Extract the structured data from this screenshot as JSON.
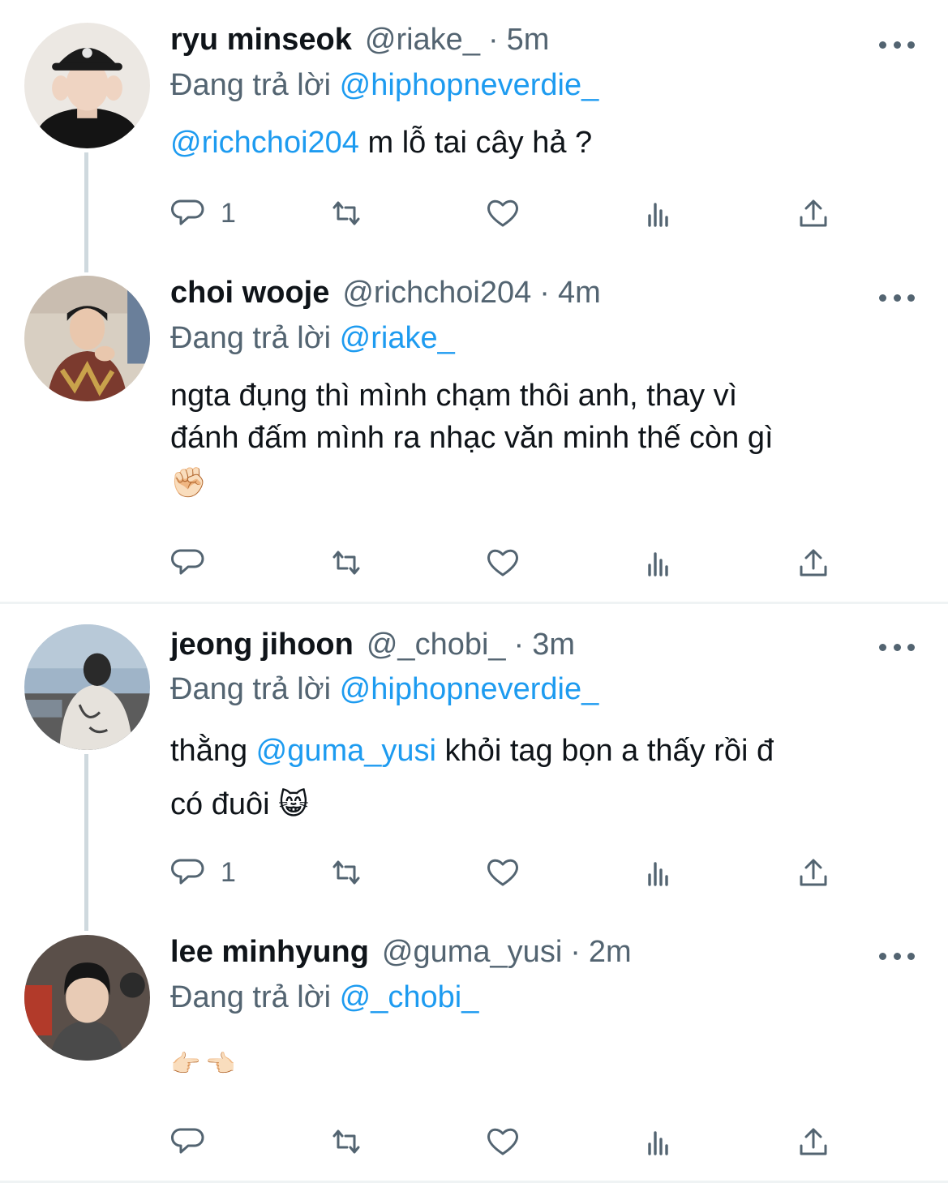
{
  "tweets": [
    {
      "name": "ryu minseok",
      "handle": "@riake_",
      "separator": "·",
      "time": "5m",
      "replying_prefix": "Đang trả lời",
      "replying_to": "@hiphopneverdie_",
      "body_mention": "@richchoi204",
      "body_text": " m lỗ tai cây hả ?",
      "reply_count": "1"
    },
    {
      "name": "choi wooje",
      "handle": "@richchoi204",
      "separator": "·",
      "time": "4m",
      "replying_prefix": "Đang trả lời",
      "replying_to": "@riake_",
      "body_line1": "ngta đụng thì mình chạm thôi anh, thay vì",
      "body_line2": "đánh đấm mình ra nhạc văn minh thế còn gì",
      "body_emoji": "✊🏻",
      "reply_count": ""
    },
    {
      "name": "jeong jihoon",
      "handle": "@_chobi_",
      "separator": "·",
      "time": "3m",
      "replying_prefix": "Đang trả lời",
      "replying_to": "@hiphopneverdie_",
      "body_pre": "thằng ",
      "body_mention": "@guma_yusi",
      "body_post": " khỏi tag bọn a thấy rồi đ",
      "body_line2": "có đuôi ",
      "body_emoji": "😸",
      "reply_count": "1"
    },
    {
      "name": "lee minhyung",
      "handle": "@guma_yusi",
      "separator": "·",
      "time": "2m",
      "replying_prefix": "Đang trả lời",
      "replying_to": "@_chobi_",
      "body_emoji": "👉🏻👈🏻",
      "reply_count": ""
    }
  ],
  "icons": {
    "reply": "reply-icon",
    "retweet": "retweet-icon",
    "like": "like-icon",
    "views": "views-icon",
    "share": "share-icon",
    "more": "more-icon"
  },
  "colors": {
    "text": "#0f1419",
    "secondary": "#536471",
    "link": "#1d9bf0",
    "divider": "#eff3f4",
    "thread_line": "#cfd9de"
  }
}
